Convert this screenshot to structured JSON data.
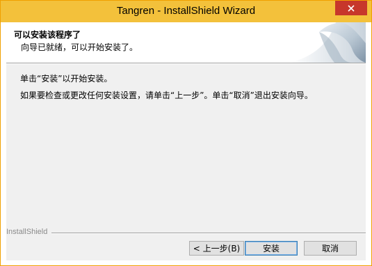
{
  "window": {
    "title": "Tangren - InstallShield Wizard",
    "close_icon": "close-icon"
  },
  "header": {
    "title": "可以安装该程序了",
    "subtitle": "向导已就绪，可以开始安装了。",
    "art_icon": "installer-page-curl-icon"
  },
  "body": {
    "line1": "单击“安装”以开始安装。",
    "line2": "如果要检查或更改任何安装设置，请单击“上一步”。单击“取消”退出安装向导。"
  },
  "footer": {
    "brand": "InstallShield",
    "buttons": {
      "back": "< 上一步(B)",
      "install": "安装",
      "cancel": "取消"
    }
  },
  "colors": {
    "titlebar": "#f3c13b",
    "close": "#c7372b",
    "dialog_bg": "#f0f0f0"
  }
}
